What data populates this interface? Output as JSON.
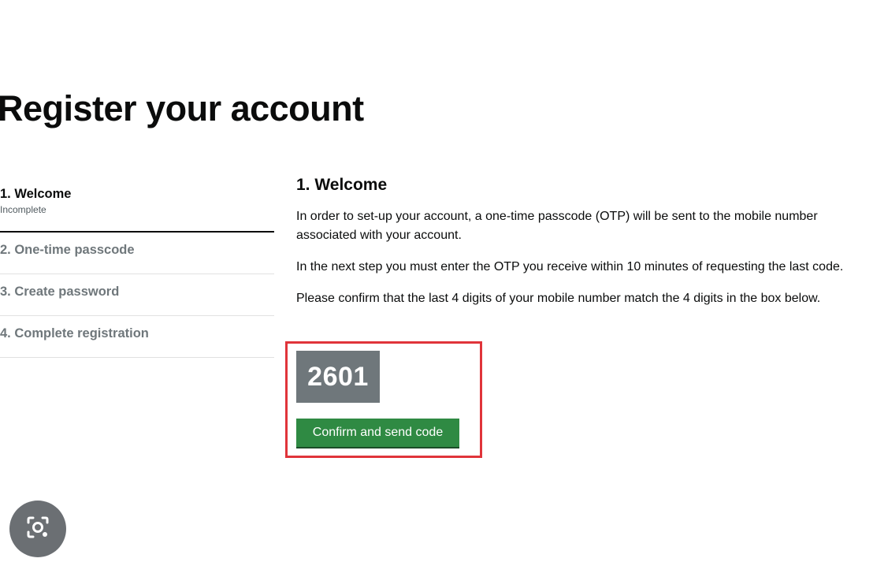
{
  "page": {
    "title": "Register your account"
  },
  "steps": [
    {
      "label": "1. Welcome",
      "status": "Incomplete",
      "active": true
    },
    {
      "label": "2. One-time passcode"
    },
    {
      "label": "3. Create password"
    },
    {
      "label": "4. Complete registration"
    }
  ],
  "content": {
    "heading": "1. Welcome",
    "paragraphs": [
      "In order to set-up your account, a one-time passcode (OTP) will be sent to the mobile number associated with your account.",
      "In the next step you must enter the OTP you receive within 10 minutes of requesting the last code.",
      "Please confirm that the last 4 digits of your mobile number match the 4 digits in the box below."
    ],
    "mobile_last_digits": "2601",
    "confirm_button_label": "Confirm and send code"
  },
  "overlay": {
    "lens_icon": "camera-search-icon"
  },
  "colors": {
    "button_green": "#2f8a43",
    "code_box_grey": "#6f777b",
    "highlight_red": "#e0343a"
  }
}
